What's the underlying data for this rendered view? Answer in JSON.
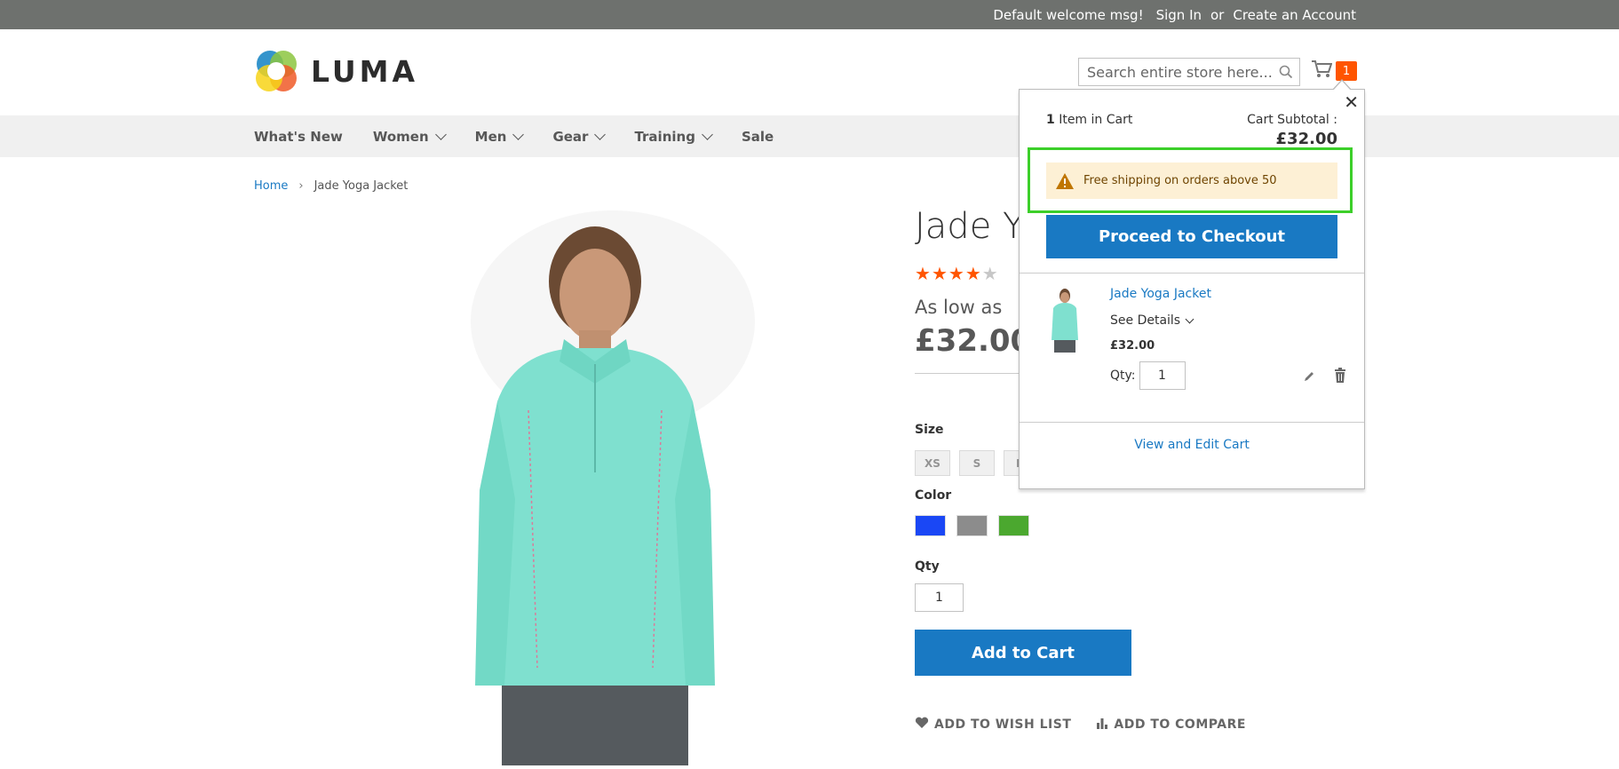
{
  "topbar": {
    "welcome": "Default welcome msg!",
    "sign_in": "Sign In",
    "or": "or",
    "create_account": "Create an Account"
  },
  "header": {
    "logo_text": "LUMA",
    "search_placeholder": "Search entire store here...",
    "cart_count": "1"
  },
  "nav": {
    "items": [
      {
        "label": "What's New",
        "has_menu": false
      },
      {
        "label": "Women",
        "has_menu": true
      },
      {
        "label": "Men",
        "has_menu": true
      },
      {
        "label": "Gear",
        "has_menu": true
      },
      {
        "label": "Training",
        "has_menu": true
      },
      {
        "label": "Sale",
        "has_menu": false
      }
    ]
  },
  "breadcrumb": {
    "home": "Home",
    "current": "Jade Yoga Jacket"
  },
  "product": {
    "title_visible": "Jade Yo",
    "rating_stars": 4,
    "rating_max": 5,
    "as_low_as": "As low as",
    "price": "£32.00",
    "size_label": "Size",
    "sizes": [
      "XS",
      "S",
      "M"
    ],
    "color_label": "Color",
    "colors": [
      "#1a47f5",
      "#8c8c8c",
      "#4ba82f"
    ],
    "qty_label": "Qty",
    "qty_value": "1",
    "add_to_cart": "Add to Cart",
    "wishlist": "ADD TO WISH LIST",
    "compare": "ADD TO COMPARE"
  },
  "minicart": {
    "item_count": "1",
    "items_in_cart": "Item in Cart",
    "subtotal_label": "Cart Subtotal :",
    "subtotal_amount": "£32.00",
    "notice": "Free shipping on orders above 50",
    "checkout": "Proceed to Checkout",
    "item": {
      "name": "Jade Yoga Jacket",
      "see_details": "See Details",
      "price": "£32.00",
      "qty_label": "Qty:",
      "qty_value": "1"
    },
    "view_edit_cart": "View and Edit Cart"
  },
  "colors": {
    "accent_blue": "#1979c3",
    "counter_orange": "#ff5501",
    "highlight_green": "#3ccf2a"
  }
}
